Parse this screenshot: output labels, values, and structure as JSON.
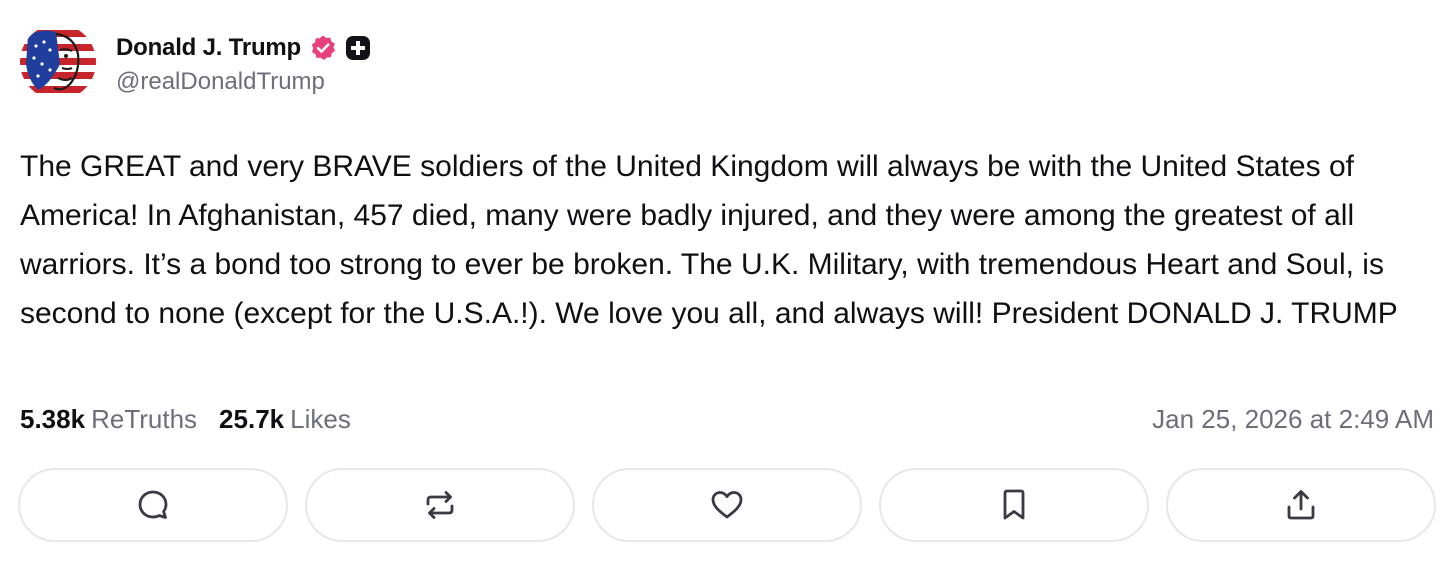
{
  "author": {
    "display_name": "Donald J. Trump",
    "handle": "@realDonaldTrump",
    "verified_icon": "verified-badge-icon",
    "badge_icon": "plus-badge-icon",
    "verified_color": "#e8407a"
  },
  "post": {
    "text": "The GREAT and very BRAVE soldiers of the United Kingdom will always be with the United States of America! In Afghanistan, 457 died, many were badly injured, and they were among the greatest of all warriors. It’s a bond too strong to ever be broken. The U.K. Military, with tremendous Heart and Soul, is second to none (except for the U.S.A.!). We love you all, and always will! President DONALD J. TRUMP",
    "timestamp": "Jan 25, 2026 at 2:49 AM"
  },
  "stats": {
    "retruths_count": "5.38k",
    "retruths_label": "ReTruths",
    "likes_count": "25.7k",
    "likes_label": "Likes"
  },
  "actions": [
    {
      "icon": "reply-icon"
    },
    {
      "icon": "retruth-icon"
    },
    {
      "icon": "heart-icon"
    },
    {
      "icon": "bookmark-icon"
    },
    {
      "icon": "share-icon"
    }
  ]
}
